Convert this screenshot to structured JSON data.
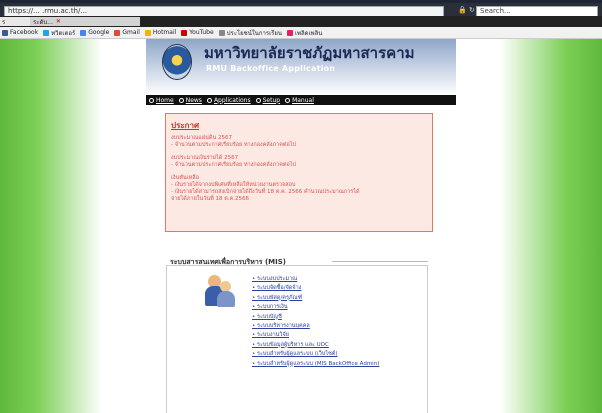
{
  "browser": {
    "url": "https://... .rmu.ac.th/...",
    "secure_icon": "lock-icon",
    "search_placeholder": "Search...",
    "tabs": [
      {
        "label": "ร"
      },
      {
        "label": "ระดับ..."
      }
    ],
    "favorites": [
      {
        "label": "Facebook",
        "color": "#3b5998"
      },
      {
        "label": "ทวิตเตอร์",
        "color": "#1da1f2"
      },
      {
        "label": "Google",
        "color": "#4285f4"
      },
      {
        "label": "Gmail",
        "color": "#dd4b39"
      },
      {
        "label": "Hotmail",
        "color": "#f4b400"
      },
      {
        "label": "YouTube",
        "color": "#cc0000"
      },
      {
        "label": "ประโยชน์ในการเรียน",
        "color": "#888888"
      },
      {
        "label": "เพลิดเพลิน",
        "color": "#e91e63"
      }
    ]
  },
  "header": {
    "title": "มหาวิทยาลัยราชภัฏมหาสารคาม",
    "subtitle": "RMU Backoffice Application"
  },
  "menu": [
    {
      "label": "Home"
    },
    {
      "label": "News"
    },
    {
      "label": "Applications"
    },
    {
      "label": "Setup"
    },
    {
      "label": "Manual"
    }
  ],
  "announcement": {
    "title": "ประกาศ",
    "lines": [
      "งบประมาณแผ่นดิน 2567",
      "- จำนวนตามประกาศเรียบร้อย ทางกองคลังภาคต่อไป",
      "",
      "งบประมาณเงินรายได้ 2567",
      "- จำนวนตามประกาศเรียบร้อย ทางกองคลังภาคต่อไป",
      "",
      "เงินทันเหลือ",
      "- เงินรายได้จากงบพิเศษที่เหลือให้หน่วยงานตรวจสอบ",
      "- เงินรายได้สามารถส่งเบิกจ่ายได้ถึงวันที่ 18 ต.ค. 2566 คำนวณประมาณการได้",
      "จ่ายได้ภายในวันที่ 18 ต.ค.2566"
    ]
  },
  "mis": {
    "title": "ระบบสารสนเทศเพื่อการบริหาร (MIS)",
    "items": [
      "ระบบงบประมาณ",
      "ระบบจัดซื้อ/จัดจ้าง",
      "ระบบพัสดุ/ครุภัณฑ์",
      "ระบบการเงิน",
      "ระบบบัญชี",
      "ระบบบริหารงานบุคคล",
      "ระบบงานวิจัย",
      "ระบบข้อมูลผู้บริหาร และ UOC",
      "ระบบสำหรับผู้ดูแลระบบ (เว็บไซต์)",
      "ระบบสำหรับผู้ดูแลระบบ (MIS BackOffice Admin)"
    ]
  }
}
